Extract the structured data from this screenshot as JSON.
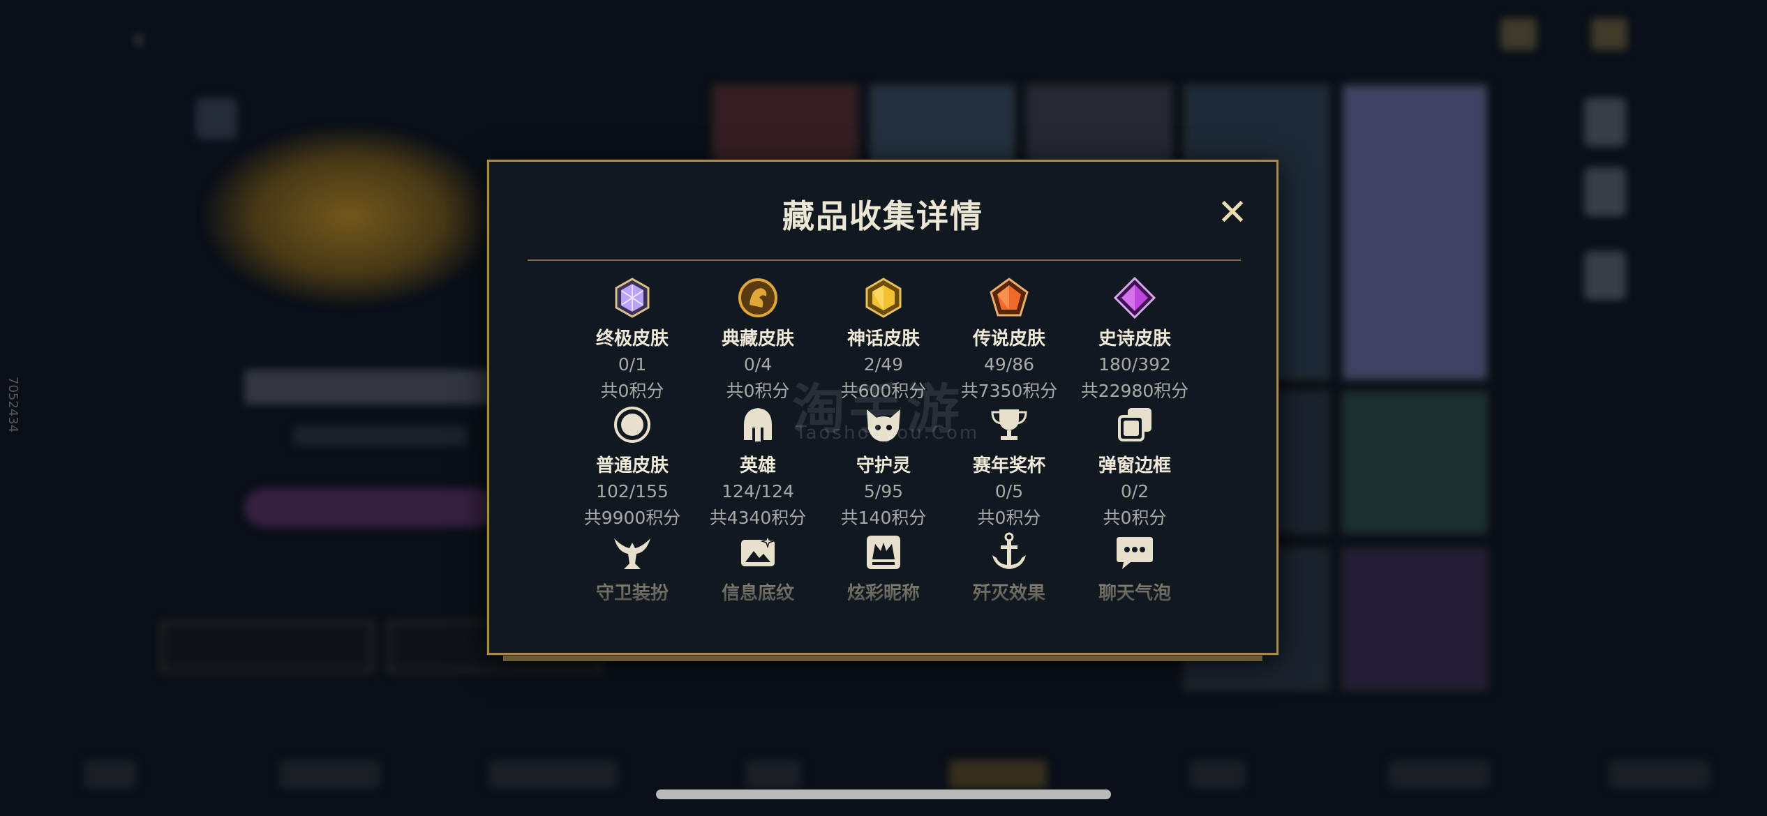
{
  "dialog": {
    "title": "藏品收集详情",
    "close_label": "✕"
  },
  "rows": [
    [
      {
        "label": "终极皮肤",
        "count": "0/1",
        "points": "共0积分",
        "icon": "ultimate-skin-icon",
        "color": "#b9a3ff"
      },
      {
        "label": "典藏皮肤",
        "count": "0/4",
        "points": "共0积分",
        "icon": "prestige-skin-icon",
        "color": "#e0a63a"
      },
      {
        "label": "神话皮肤",
        "count": "2/49",
        "points": "共600积分",
        "icon": "mythic-skin-icon",
        "color": "#f2c230"
      },
      {
        "label": "传说皮肤",
        "count": "49/86",
        "points": "共7350积分",
        "icon": "legendary-skin-icon",
        "color": "#f06a2a"
      },
      {
        "label": "史诗皮肤",
        "count": "180/392",
        "points": "共22980积分",
        "icon": "epic-skin-icon",
        "color": "#c045e0"
      }
    ],
    [
      {
        "label": "普通皮肤",
        "count": "102/155",
        "points": "共9900积分",
        "icon": "normal-skin-icon",
        "color": "#e6e0cc"
      },
      {
        "label": "英雄",
        "count": "124/124",
        "points": "共4340积分",
        "icon": "champion-helmet-icon",
        "color": "#e6e0cc"
      },
      {
        "label": "守护灵",
        "count": "5/95",
        "points": "共140积分",
        "icon": "guardian-icon",
        "color": "#e6e0cc"
      },
      {
        "label": "赛年奖杯",
        "count": "0/5",
        "points": "共0积分",
        "icon": "trophy-icon",
        "color": "#e6e0cc"
      },
      {
        "label": "弹窗边框",
        "count": "0/2",
        "points": "共0积分",
        "icon": "frame-icon",
        "color": "#e6e0cc"
      }
    ],
    [
      {
        "label": "守卫装扮",
        "icon": "ward-skin-icon",
        "color": "#e6e0cc"
      },
      {
        "label": "信息底纹",
        "icon": "info-banner-icon",
        "color": "#e6e0cc"
      },
      {
        "label": "炫彩昵称",
        "icon": "colored-name-icon",
        "color": "#e6e0cc"
      },
      {
        "label": "歼灭效果",
        "icon": "finisher-anchor-icon",
        "color": "#e6e0cc"
      },
      {
        "label": "聊天气泡",
        "icon": "chat-bubble-icon",
        "color": "#e6e0cc"
      }
    ]
  ],
  "watermark": {
    "main": "淘手游",
    "sub": "Taoshouyou.Com"
  },
  "side_id": "7052434"
}
